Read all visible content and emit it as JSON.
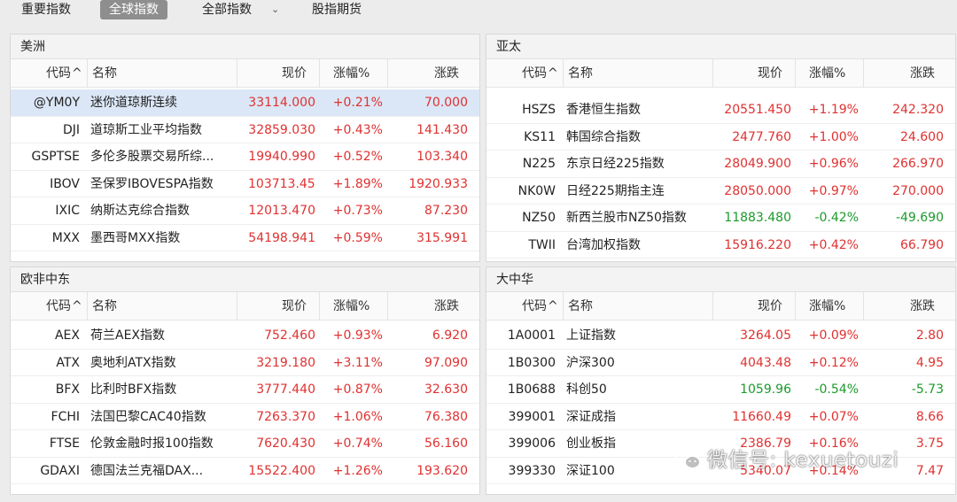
{
  "tabs": [
    {
      "label": "重要指数",
      "active": false
    },
    {
      "label": "全球指数",
      "active": true
    },
    {
      "label": "全部指数",
      "active": false
    },
    {
      "label": "股指期货",
      "active": false
    }
  ],
  "columns": {
    "code": "代码",
    "name": "名称",
    "price": "现价",
    "pct": "涨幅%",
    "chg": "涨跌"
  },
  "colors": {
    "up": "#e03131",
    "down": "#1c9a2c",
    "selected_row": "#dbe7f6"
  },
  "panels": {
    "americas": {
      "title": "美洲",
      "rows": [
        {
          "code": "@YM0Y",
          "name": "迷你道琼斯连续",
          "price": "33114.000",
          "pct": "+0.21%",
          "chg": "70.000",
          "dir": "up",
          "selected": true
        },
        {
          "code": "DJI",
          "name": "道琼斯工业平均指数",
          "price": "32859.030",
          "pct": "+0.43%",
          "chg": "141.430",
          "dir": "up"
        },
        {
          "code": "GSPTSE",
          "name": "多伦多股票交易所综...",
          "price": "19940.990",
          "pct": "+0.52%",
          "chg": "103.340",
          "dir": "up"
        },
        {
          "code": "IBOV",
          "name": "圣保罗IBOVESPA指数",
          "price": "103713.453",
          "pct": "+1.89%",
          "chg": "1920.933",
          "dir": "up"
        },
        {
          "code": "IXIC",
          "name": "纳斯达克综合指数",
          "price": "12013.470",
          "pct": "+0.73%",
          "chg": "87.230",
          "dir": "up"
        },
        {
          "code": "MXX",
          "name": "墨西哥MXX指数",
          "price": "54198.941",
          "pct": "+0.59%",
          "chg": "315.991",
          "dir": "up"
        }
      ]
    },
    "asia_pacific": {
      "title": "亚太",
      "rows": [
        {
          "code": "HSZS",
          "name": "香港恒生指数",
          "price": "20551.450",
          "pct": "+1.19%",
          "chg": "242.320",
          "dir": "up"
        },
        {
          "code": "KS11",
          "name": "韩国综合指数",
          "price": "2477.760",
          "pct": "+1.00%",
          "chg": "24.600",
          "dir": "up"
        },
        {
          "code": "N225",
          "name": "东京日经225指数",
          "price": "28049.900",
          "pct": "+0.96%",
          "chg": "266.970",
          "dir": "up"
        },
        {
          "code": "NK0W",
          "name": "日经225期指主连",
          "price": "28050.000",
          "pct": "+0.97%",
          "chg": "270.000",
          "dir": "up"
        },
        {
          "code": "NZ50",
          "name": "新西兰股市NZ50指数",
          "price": "11883.480",
          "pct": "-0.42%",
          "chg": "-49.690",
          "dir": "down"
        },
        {
          "code": "TWII",
          "name": "台湾加权指数",
          "price": "15916.220",
          "pct": "+0.42%",
          "chg": "66.790",
          "dir": "up"
        }
      ]
    },
    "emea": {
      "title": "欧非中东",
      "rows": [
        {
          "code": "AEX",
          "name": "荷兰AEX指数",
          "price": "752.460",
          "pct": "+0.93%",
          "chg": "6.920",
          "dir": "up"
        },
        {
          "code": "ATX",
          "name": "奥地利ATX指数",
          "price": "3219.180",
          "pct": "+3.11%",
          "chg": "97.090",
          "dir": "up"
        },
        {
          "code": "BFX",
          "name": "比利时BFX指数",
          "price": "3777.440",
          "pct": "+0.87%",
          "chg": "32.630",
          "dir": "up"
        },
        {
          "code": "FCHI",
          "name": "法国巴黎CAC40指数",
          "price": "7263.370",
          "pct": "+1.06%",
          "chg": "76.380",
          "dir": "up"
        },
        {
          "code": "FTSE",
          "name": "伦敦金融时报100指数",
          "price": "7620.430",
          "pct": "+0.74%",
          "chg": "56.160",
          "dir": "up"
        },
        {
          "code": "GDAXI",
          "name": "德国法兰克福DAX...",
          "price": "15522.400",
          "pct": "+1.26%",
          "chg": "193.620",
          "dir": "up"
        }
      ]
    },
    "greater_china": {
      "title": "大中华",
      "rows": [
        {
          "code": "1A0001",
          "name": "上证指数",
          "price": "3264.05",
          "pct": "+0.09%",
          "chg": "2.80",
          "dir": "up"
        },
        {
          "code": "1B0300",
          "name": "沪深300",
          "price": "4043.48",
          "pct": "+0.12%",
          "chg": "4.95",
          "dir": "up"
        },
        {
          "code": "1B0688",
          "name": "科创50",
          "price": "1059.96",
          "pct": "-0.54%",
          "chg": "-5.73",
          "dir": "down"
        },
        {
          "code": "399001",
          "name": "深证成指",
          "price": "11660.49",
          "pct": "+0.07%",
          "chg": "8.66",
          "dir": "up"
        },
        {
          "code": "399006",
          "name": "创业板指",
          "price": "2386.79",
          "pct": "+0.16%",
          "chg": "3.75",
          "dir": "up"
        },
        {
          "code": "399330",
          "name": "深证100",
          "price": "5340.07",
          "pct": "+0.14%",
          "chg": "7.47",
          "dir": "up"
        }
      ]
    }
  },
  "watermark": {
    "text": "微信号: kexuetouzi",
    "icon": "wechat-icon"
  }
}
